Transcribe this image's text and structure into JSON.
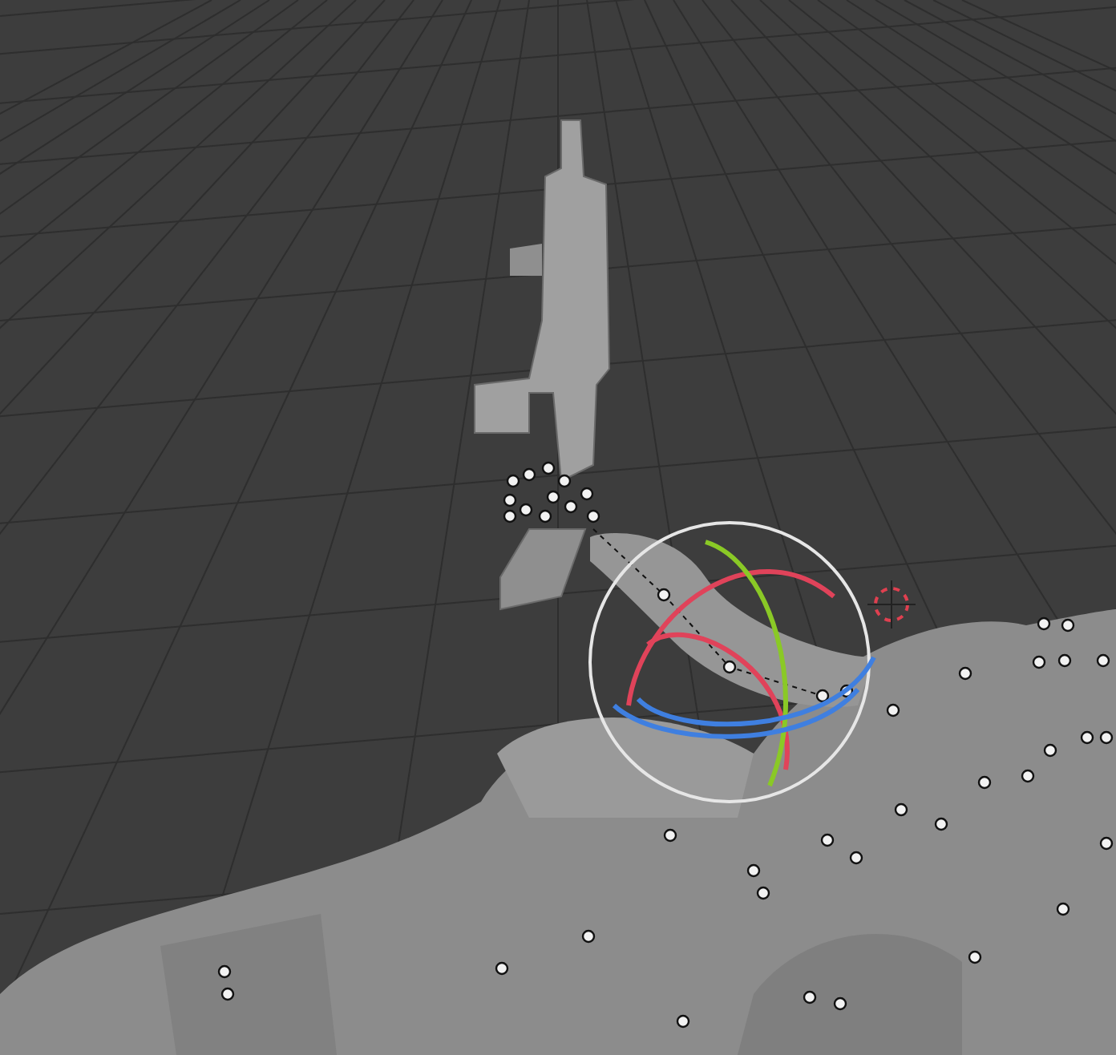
{
  "viewport": {
    "gizmo": {
      "kind": "rotate"
    }
  }
}
